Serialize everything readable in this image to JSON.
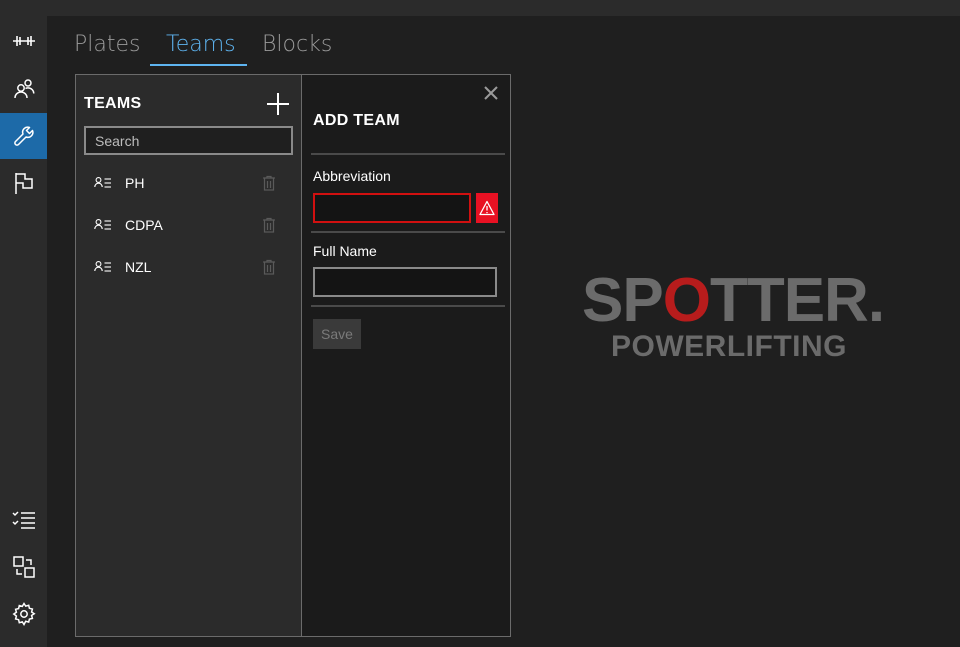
{
  "rail": {
    "items": [
      {
        "icon": "barbell-icon"
      },
      {
        "icon": "people-icon"
      },
      {
        "icon": "wrench-icon",
        "active": true
      },
      {
        "icon": "flag-icon"
      },
      {
        "icon": "checklist-icon"
      },
      {
        "icon": "swap-icon"
      },
      {
        "icon": "gear-icon"
      }
    ],
    "accent": "#1d6aa8"
  },
  "tabs": [
    {
      "label": "Plates"
    },
    {
      "label": "Teams",
      "active": true
    },
    {
      "label": "Blocks"
    }
  ],
  "teams": {
    "title": "TEAMS",
    "search_placeholder": "Search",
    "items": [
      {
        "name": "PH"
      },
      {
        "name": "CDPA"
      },
      {
        "name": "NZL"
      }
    ]
  },
  "add_team": {
    "title": "ADD TEAM",
    "abbreviation_label": "Abbreviation",
    "abbreviation_value": "",
    "full_name_label": "Full Name",
    "full_name_value": "",
    "save_label": "Save",
    "error_color": "#e81123"
  },
  "logo": {
    "main_prefix": "SP",
    "main_o": "O",
    "main_suffix": "TTER.",
    "sub": "POWERLIFTING"
  }
}
